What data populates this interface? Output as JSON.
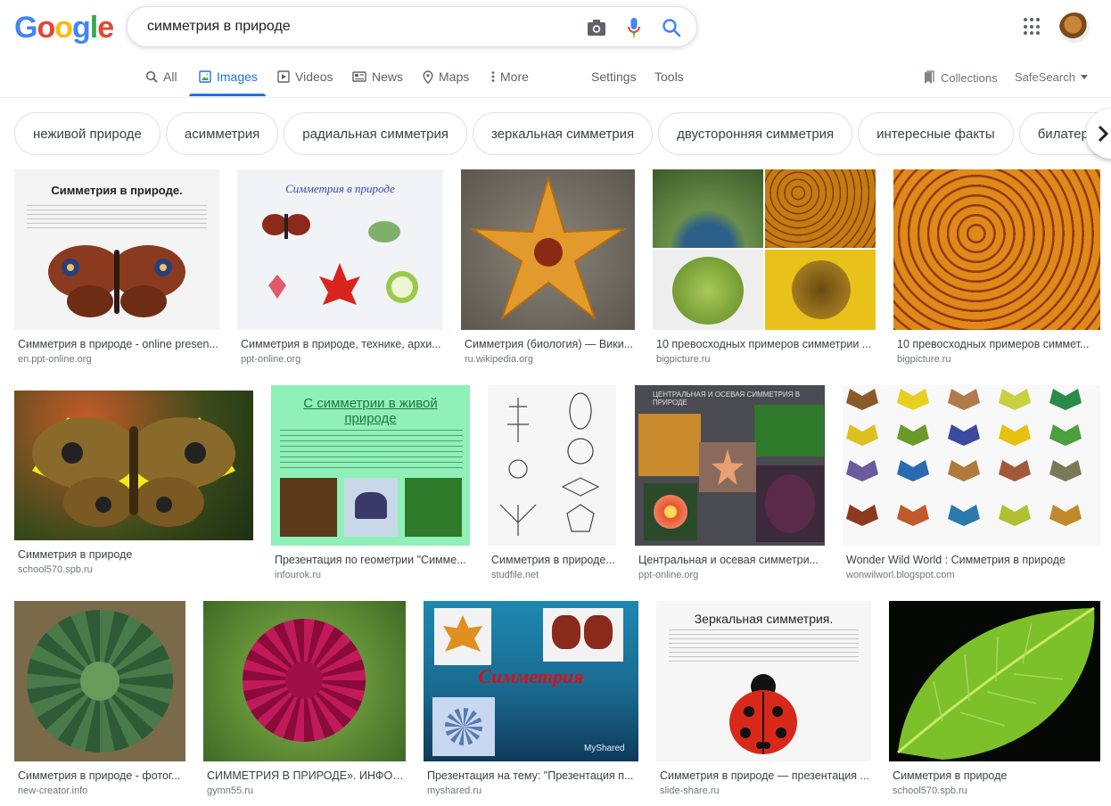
{
  "logo": [
    "G",
    "o",
    "o",
    "g",
    "l",
    "e"
  ],
  "logo_colors": [
    "#4285F4",
    "#EA4335",
    "#FBBC05",
    "#4285F4",
    "#34A853",
    "#EA4335"
  ],
  "search": {
    "value": "симметрия в природе"
  },
  "tabs": {
    "all": "All",
    "images": "Images",
    "videos": "Videos",
    "news": "News",
    "maps": "Maps",
    "more": "More",
    "settings": "Settings",
    "tools": "Tools",
    "collections": "Collections",
    "safesearch": "SafeSearch"
  },
  "chips": [
    "неживой природе",
    "асимметрия",
    "радиальная симметрия",
    "зеркальная симметрия",
    "двусторонняя симметрия",
    "интересные факты",
    "билатеральн"
  ],
  "results": [
    {
      "caption": "Симметрия в природе - online presen...",
      "source": "en.ppt-online.org",
      "thumb_title": "Симметрия в природе."
    },
    {
      "caption": "Симметрия в природе, технике, архи...",
      "source": "ppt-online.org",
      "thumb_title": "Симметрия в природе"
    },
    {
      "caption": "Симметрия (биология) — Вики...",
      "source": "ru.wikipedia.org"
    },
    {
      "caption": "10 превосходных примеров симметрии ...",
      "source": "bigpicture.ru"
    },
    {
      "caption": "10 превосходных примеров симмет...",
      "source": "bigpicture.ru"
    },
    {
      "caption": "Симметрия в природе",
      "source": "school570.spb.ru"
    },
    {
      "caption": "Презентация по геометрии \"Симме...",
      "source": "infourok.ru",
      "thumb_title": "С симметрии в живой природе"
    },
    {
      "caption": "Симметрия в природе...",
      "source": "studfile.net"
    },
    {
      "caption": "Центральная и осевая симметри...",
      "source": "ppt-online.org",
      "thumb_title": "ЦЕНТРАЛЬНАЯ И ОСЕВАЯ СИММЕТРИЯ В ПРИРОДЕ"
    },
    {
      "caption": "Wonder Wild World : Симметрия в природе",
      "source": "wonwilworl.blogspot.com"
    },
    {
      "caption": "Симметрия в природе - фотог...",
      "source": "new-creator.info"
    },
    {
      "caption": "СИММЕТРИЯ В ПРИРОДЕ». ИНФОР...",
      "source": "gymn55.ru"
    },
    {
      "caption": "Презентация на тему: \"Презентация п...",
      "source": "myshared.ru",
      "thumb_title": "Симметрия",
      "watermark": "MyShared"
    },
    {
      "caption": "Симметрия в природе — презентация ...",
      "source": "slide-share.ru",
      "thumb_title": "Зеркальная симметрия."
    },
    {
      "caption": "Симметрия в природе",
      "source": "school570.spb.ru"
    }
  ]
}
